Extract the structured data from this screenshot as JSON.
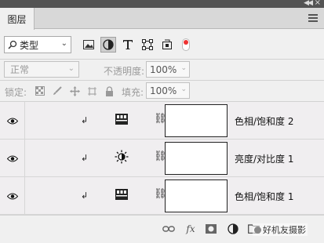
{
  "panel": {
    "tab_label": "图层"
  },
  "filter": {
    "kind_label": "类型",
    "icons": [
      "image-filter-icon",
      "adjustment-filter-icon",
      "type-filter-icon",
      "shape-filter-icon",
      "smart-object-filter-icon",
      "filter-toggle-icon"
    ]
  },
  "blend": {
    "mode": "正常",
    "opacity_label": "不透明度:",
    "opacity_value": "100%"
  },
  "lock": {
    "label": "锁定:",
    "fill_label": "填充:",
    "fill_value": "100%"
  },
  "layers": [
    {
      "name": "色相/饱和度 2",
      "icon": "hue-saturation-icon"
    },
    {
      "name": "亮度/对比度 1",
      "icon": "brightness-contrast-icon"
    },
    {
      "name": "色相/饱和度 1",
      "icon": "hue-saturation-icon"
    }
  ],
  "footer": {
    "fx_label": "fx",
    "watermark": "好机友摄影"
  },
  "colors": {
    "accent_red": "#e33333",
    "panel_bg": "#f0f0f0",
    "layer_bg": "#f0eef0"
  }
}
